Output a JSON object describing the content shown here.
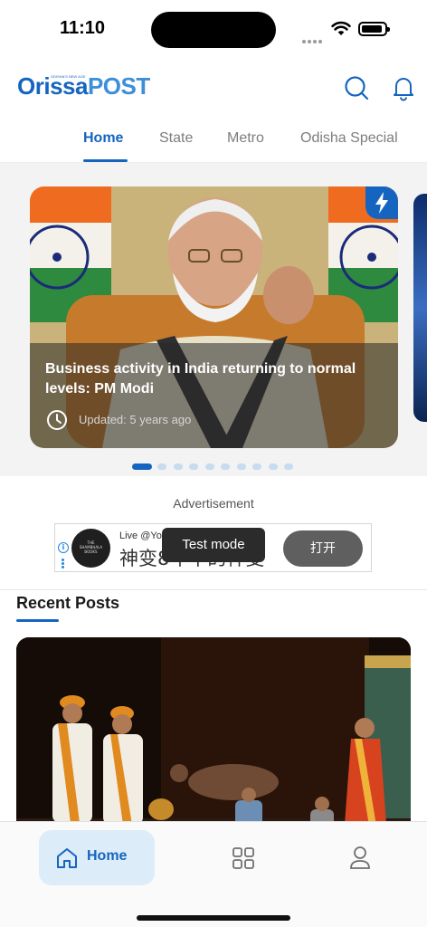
{
  "status_bar": {
    "time": "11:10"
  },
  "header": {
    "logo_part1": "Orissa",
    "logo_part2": "POST",
    "logo_tagline": "ODISHA'S NEW AGE",
    "tabs": [
      "Home",
      "State",
      "Metro",
      "Odisha Special"
    ],
    "active_tab": "Home"
  },
  "featured": {
    "title": "Business activity in India returning to normal levels: PM Modi",
    "updated": "Updated: 5 years ago",
    "slide_count": 11,
    "active_index": 0
  },
  "ad": {
    "label": "Advertisement",
    "logo_text": "THE SHAMBHALA BOOKS",
    "live_text": "Live @You",
    "headline": "神变8年中的神变",
    "cta": "打开",
    "toast": "Test mode"
  },
  "recent": {
    "title": "Recent Posts"
  },
  "bottom_nav": {
    "home_label": "Home"
  },
  "colors": {
    "brand": "#1565c0",
    "tab_inactive": "#7d7d7d",
    "nav_active_bg": "#dcecf8"
  }
}
